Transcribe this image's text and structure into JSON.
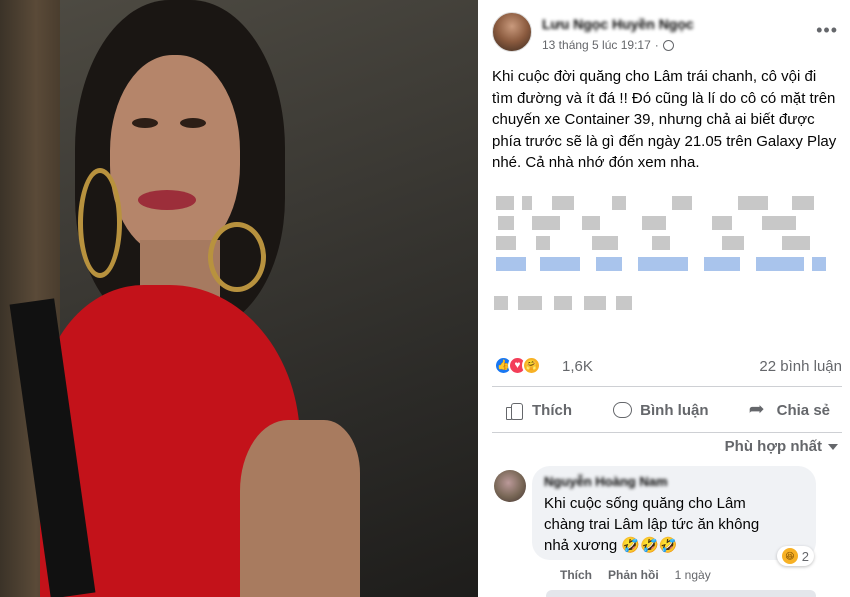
{
  "post": {
    "author": "Lưu Ngọc Huyền Ngọc",
    "date": "13 tháng 5 lúc 19:17",
    "privacy_icon": "globe-icon",
    "more_icon": "•••",
    "text": "Khi cuộc đời quăng cho Lâm trái chanh, cô vội đi tìm đường và ít đá !! Đó cũng là lí do cô có mặt trên chuyến xe Container 39, nhưng chả ai biết được phía trước sẽ là gì đến ngày 21.05 trên Galaxy Play nhé. Cả nhà nhớ đón xem nha."
  },
  "reactions": {
    "types": [
      "like",
      "love",
      "care"
    ],
    "like_symbol": "👍",
    "love_symbol": "♥",
    "care_symbol": "🤗",
    "count": "1,6K",
    "comments": "22 bình luận"
  },
  "actions": {
    "like": "Thích",
    "comment": "Bình luận",
    "share": "Chia sẻ"
  },
  "sort": {
    "label": "Phù hợp nhất"
  },
  "comment": {
    "author": "Nguyễn Hoàng Nam",
    "text": "Khi cuộc sống quăng cho Lâm chàng trai Lâm lập tức ăn không nhả xương 🤣🤣🤣",
    "reaction_icon": "😆",
    "reaction_count": "2",
    "like": "Thích",
    "reply": "Phản hồi",
    "time": "1 ngày"
  },
  "colors": {
    "accent": "#1877f2",
    "secondary_text": "#65676b",
    "bubble": "#f0f2f5"
  }
}
